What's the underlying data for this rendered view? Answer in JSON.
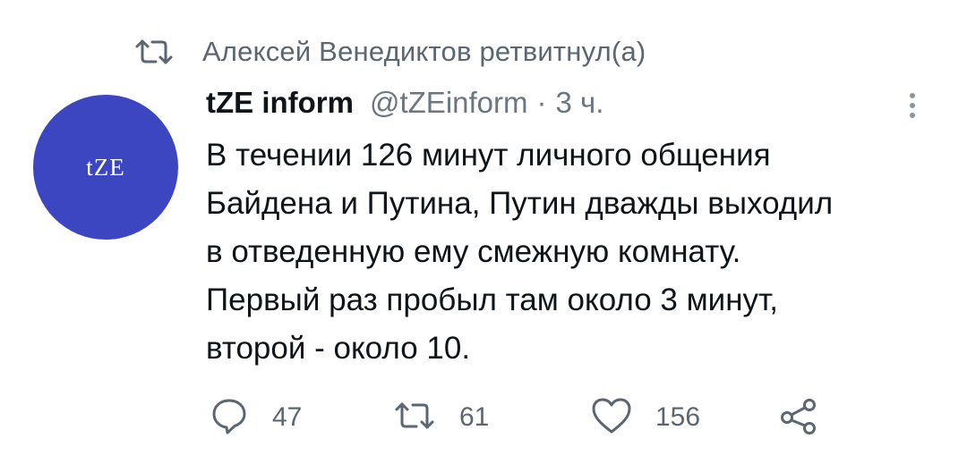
{
  "retweet": {
    "icon": "retweet-icon",
    "text": "Алексей Венедиктов ретвитнул(а)"
  },
  "tweet": {
    "avatar_text": "tZE",
    "avatar_color": "#3d46c1",
    "display_name": "tZE inform",
    "handle": "@tZEinform",
    "separator": "·",
    "time": "3 ч.",
    "text": "В течении 126 минут личного общения\nБайдена и Путина,  Путин дважды выходил\nв отведенную ему смежную комнату.\nПервый раз пробыл там около 3 минут,\nвторой - около 10.",
    "more_icon": "more-vertical-icon"
  },
  "actions": {
    "reply": {
      "icon": "reply-icon",
      "count": "47"
    },
    "retweet": {
      "icon": "retweet-icon",
      "count": "61"
    },
    "like": {
      "icon": "heart-icon",
      "count": "156"
    },
    "share": {
      "icon": "share-icon"
    }
  },
  "colors": {
    "text_primary": "#0f1419",
    "text_secondary": "#5b6670",
    "background": "#ffffff"
  }
}
